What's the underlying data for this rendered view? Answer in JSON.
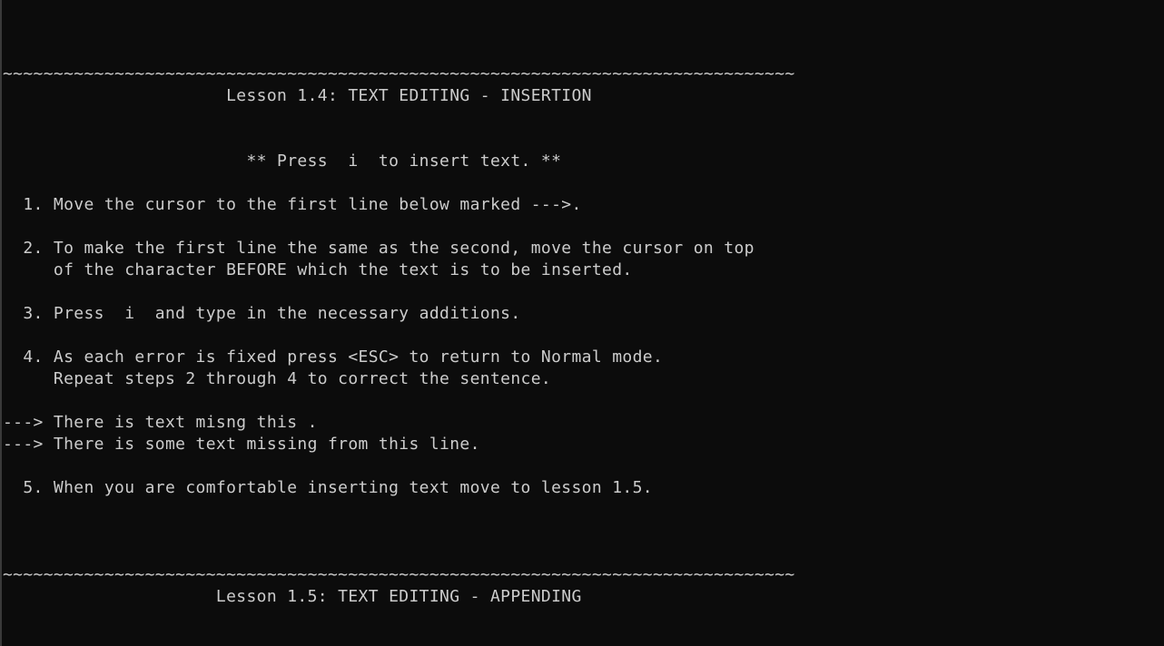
{
  "terminal": {
    "lines": [
      "~~~~~~~~~~~~~~~~~~~~~~~~~~~~~~~~~~~~~~~~~~~~~~~~~~~~~~~~~~~~~~~~~~~~~~~~~~~~~~",
      "                      Lesson 1.4: TEXT EDITING - INSERTION",
      "",
      "",
      "                        ** Press  i  to insert text. **",
      "",
      "  1. Move the cursor to the first line below marked --->.",
      "",
      "  2. To make the first line the same as the second, move the cursor on top",
      "     of the character BEFORE which the text is to be inserted.",
      "",
      "  3. Press  i  and type in the necessary additions.",
      "",
      "  4. As each error is fixed press <ESC> to return to Normal mode.",
      "     Repeat steps 2 through 4 to correct the sentence.",
      "",
      "---> There is text misng this .",
      "---> There is some text missing from this line.",
      "",
      "  5. When you are comfortable inserting text move to lesson 1.5.",
      "",
      "",
      "",
      "~~~~~~~~~~~~~~~~~~~~~~~~~~~~~~~~~~~~~~~~~~~~~~~~~~~~~~~~~~~~~~~~~~~~~~~~~~~~~~",
      "                     Lesson 1.5: TEXT EDITING - APPENDING"
    ]
  }
}
